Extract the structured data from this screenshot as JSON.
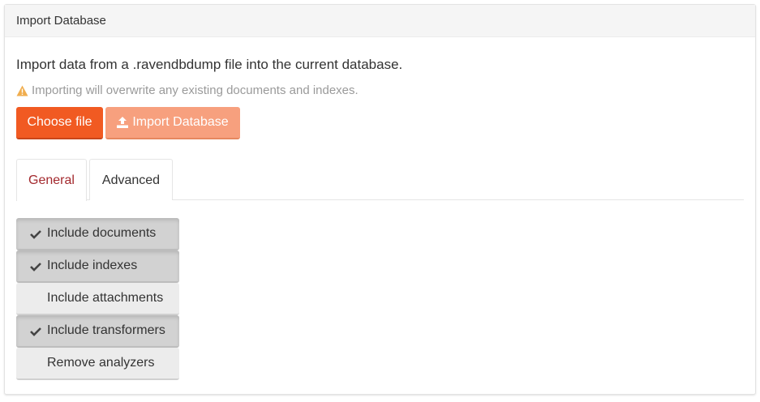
{
  "panel": {
    "title": "Import Database"
  },
  "intro_text": "Import data from a .ravendbdump file into the current database.",
  "warning": {
    "icon": "warning-triangle-icon",
    "text": "Importing will overwrite any existing documents and indexes.",
    "color": "#f0ad4e"
  },
  "buttons": {
    "choose_file": "Choose file",
    "import": "Import Database",
    "import_icon": "upload-icon"
  },
  "tabs": [
    {
      "label": "General",
      "active": true
    },
    {
      "label": "Advanced",
      "active": false
    }
  ],
  "options": [
    {
      "label": "Include documents",
      "checked": true
    },
    {
      "label": "Include indexes",
      "checked": true
    },
    {
      "label": "Include attachments",
      "checked": false
    },
    {
      "label": "Include transformers",
      "checked": true
    },
    {
      "label": "Remove analyzers",
      "checked": false
    }
  ],
  "colors": {
    "accent": "#f15a22",
    "accent_disabled": "#f7a07e",
    "active_tab": "#a3292e"
  }
}
